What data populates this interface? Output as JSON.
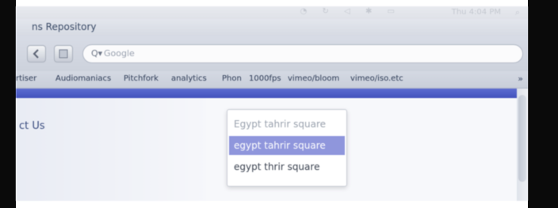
{
  "menubar": {
    "clock": "Thu 4:04 PM",
    "status_icons": [
      "wifi-icon",
      "sync-icon",
      "volume-icon",
      "bluetooth-icon",
      "battery-icon"
    ],
    "spotlight_icon": "magnifier-icon"
  },
  "window": {
    "title": "ns Repository"
  },
  "toolbar": {
    "back_icon": "back-arrow-icon",
    "bookmark_icon": "book-icon",
    "search_icon": "google-search-icon",
    "search_placeholder": "Google"
  },
  "bookmarks": {
    "items": [
      "rtiser",
      "Audiomaniacs",
      "Pitchfork",
      "analytics",
      "Phon",
      "1000fps",
      "vimeo/bloom",
      "vimeo/iso.etc"
    ],
    "more_label": "»"
  },
  "page": {
    "contact_link": "ct Us",
    "accent_color": "#4b5bc6"
  },
  "autocomplete": {
    "typed_text": "Egypt tahrir square",
    "suggestions": [
      "egypt tahrir square",
      "egypt thrir square"
    ],
    "selected_index": 0,
    "highlight_color": "#8f96dc"
  }
}
